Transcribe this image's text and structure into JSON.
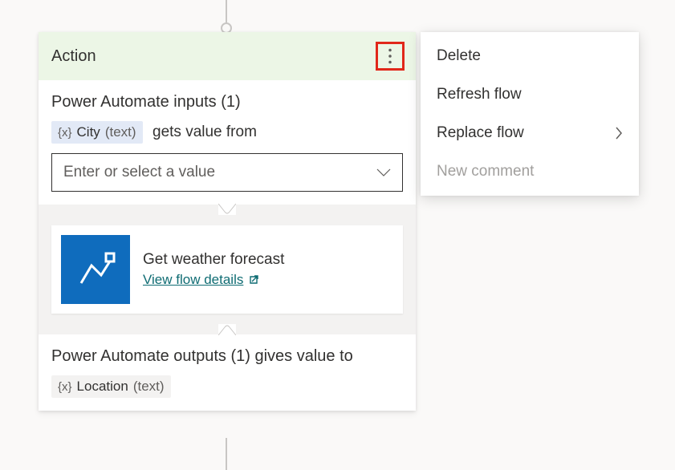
{
  "header": {
    "title": "Action"
  },
  "inputs": {
    "title": "Power Automate inputs (1)",
    "var_brace": "{x}",
    "var_name": "City",
    "var_kind": "(text)",
    "suffix": "gets value from",
    "placeholder": "Enter or select a value"
  },
  "flow": {
    "name": "Get weather forecast",
    "link_label": "View flow details"
  },
  "outputs": {
    "title": "Power Automate outputs (1) gives value to",
    "var_brace": "{x}",
    "var_name": "Location",
    "var_kind": "(text)"
  },
  "menu": {
    "delete": "Delete",
    "refresh": "Refresh flow",
    "replace": "Replace flow",
    "comment": "New comment"
  }
}
